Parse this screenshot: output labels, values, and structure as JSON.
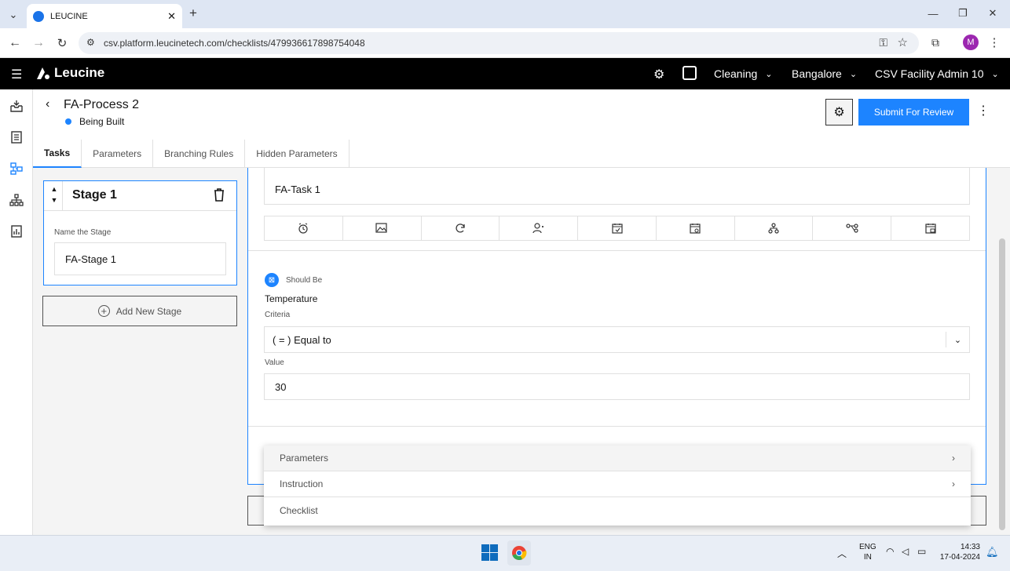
{
  "browser": {
    "tab_title": "LEUCINE",
    "url": "csv.platform.leucinetech.com/checklists/479936617898754048",
    "profile_initial": "M"
  },
  "app": {
    "brand": "Leucine",
    "use_case": "Cleaning",
    "facility": "Bangalore",
    "user": "CSV Facility Admin 10"
  },
  "process": {
    "title": "FA-Process 2",
    "status": "Being Built",
    "status_color": "#1d84ff",
    "submit_label": "Submit For Review"
  },
  "tabs": [
    "Tasks",
    "Parameters",
    "Branching Rules",
    "Hidden Parameters"
  ],
  "stage": {
    "header": "Stage 1",
    "name_label": "Name the Stage",
    "name_value": "FA-Stage 1",
    "add_label": "Add New Stage"
  },
  "task": {
    "name_value": "FA-Task 1",
    "toolbar_icons": [
      "alarm-icon",
      "image-icon",
      "refresh-icon",
      "user-assign-icon",
      "calendar-check-icon",
      "calendar-clock-icon",
      "hierarchy-icon",
      "branch-icon",
      "calendar-save-icon"
    ],
    "parameter": {
      "type_label": "Should Be",
      "name": "Temperature",
      "criteria_label": "Criteria",
      "criteria_value": "( = ) Equal to",
      "value_label": "Value",
      "value": "30"
    }
  },
  "add_menu": {
    "items": [
      "Parameters",
      "Instruction",
      "Checklist"
    ]
  },
  "taskbar": {
    "lang_top": "ENG",
    "lang_bottom": "IN",
    "time": "14:33",
    "date": "17-04-2024"
  }
}
